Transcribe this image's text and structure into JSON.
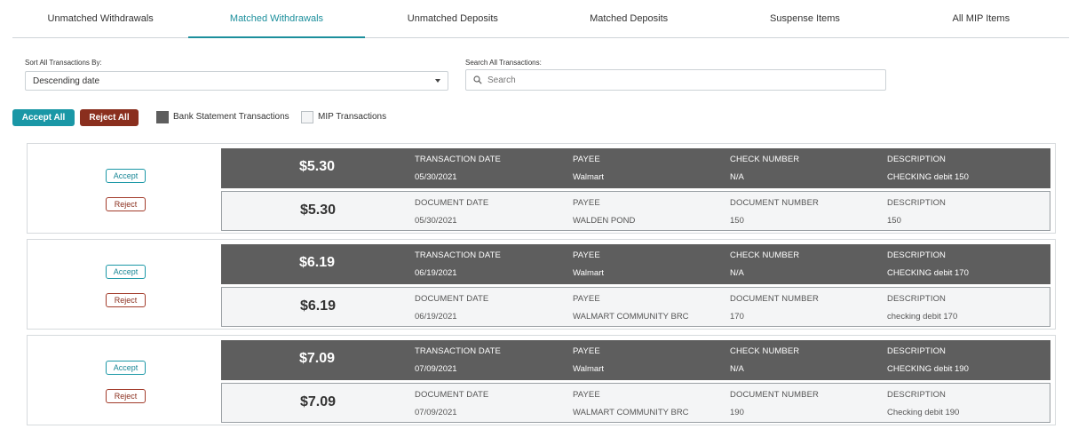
{
  "tabs": [
    {
      "label": "Unmatched Withdrawals",
      "active": false
    },
    {
      "label": "Matched Withdrawals",
      "active": true
    },
    {
      "label": "Unmatched Deposits",
      "active": false
    },
    {
      "label": "Matched Deposits",
      "active": false
    },
    {
      "label": "Suspense Items",
      "active": false
    },
    {
      "label": "All MIP Items",
      "active": false
    }
  ],
  "sort": {
    "label": "Sort All Transactions By:",
    "value": "Descending date"
  },
  "search": {
    "label": "Search All Transactions:",
    "placeholder": "Search",
    "value": ""
  },
  "actions": {
    "accept_all": "Accept All",
    "reject_all": "Reject All"
  },
  "legend": {
    "bank": {
      "label": "Bank Statement Transactions",
      "color": "#5e5e5e"
    },
    "mip": {
      "label": "MIP Transactions",
      "color": "#f4f5f6"
    }
  },
  "colors": {
    "accent": "#1a97a6",
    "reject": "#8a2f1e"
  },
  "matches": [
    {
      "accept_label": "Accept",
      "reject_label": "Reject",
      "bank": {
        "amount": "$5.30",
        "date_label": "TRANSACTION DATE",
        "date": "05/30/2021",
        "payee_label": "PAYEE",
        "payee": "Walmart",
        "number_label": "CHECK NUMBER",
        "number": "N/A",
        "desc_label": "DESCRIPTION",
        "desc": "CHECKING debit 150"
      },
      "mip": {
        "amount": "$5.30",
        "date_label": "DOCUMENT DATE",
        "date": "05/30/2021",
        "payee_label": "PAYEE",
        "payee": "WALDEN POND",
        "number_label": "DOCUMENT NUMBER",
        "number": "150",
        "desc_label": "DESCRIPTION",
        "desc": "150"
      }
    },
    {
      "accept_label": "Accept",
      "reject_label": "Reject",
      "bank": {
        "amount": "$6.19",
        "date_label": "TRANSACTION DATE",
        "date": "06/19/2021",
        "payee_label": "PAYEE",
        "payee": "Walmart",
        "number_label": "CHECK NUMBER",
        "number": "N/A",
        "desc_label": "DESCRIPTION",
        "desc": "CHECKING debit 170"
      },
      "mip": {
        "amount": "$6.19",
        "date_label": "DOCUMENT DATE",
        "date": "06/19/2021",
        "payee_label": "PAYEE",
        "payee": "WALMART COMMUNITY BRC",
        "number_label": "DOCUMENT NUMBER",
        "number": "170",
        "desc_label": "DESCRIPTION",
        "desc": "checking debit 170"
      }
    },
    {
      "accept_label": "Accept",
      "reject_label": "Reject",
      "bank": {
        "amount": "$7.09",
        "date_label": "TRANSACTION DATE",
        "date": "07/09/2021",
        "payee_label": "PAYEE",
        "payee": "Walmart",
        "number_label": "CHECK NUMBER",
        "number": "N/A",
        "desc_label": "DESCRIPTION",
        "desc": "CHECKING debit 190"
      },
      "mip": {
        "amount": "$7.09",
        "date_label": "DOCUMENT DATE",
        "date": "07/09/2021",
        "payee_label": "PAYEE",
        "payee": "WALMART COMMUNITY BRC",
        "number_label": "DOCUMENT NUMBER",
        "number": "190",
        "desc_label": "DESCRIPTION",
        "desc": "Checking debit 190"
      }
    }
  ]
}
